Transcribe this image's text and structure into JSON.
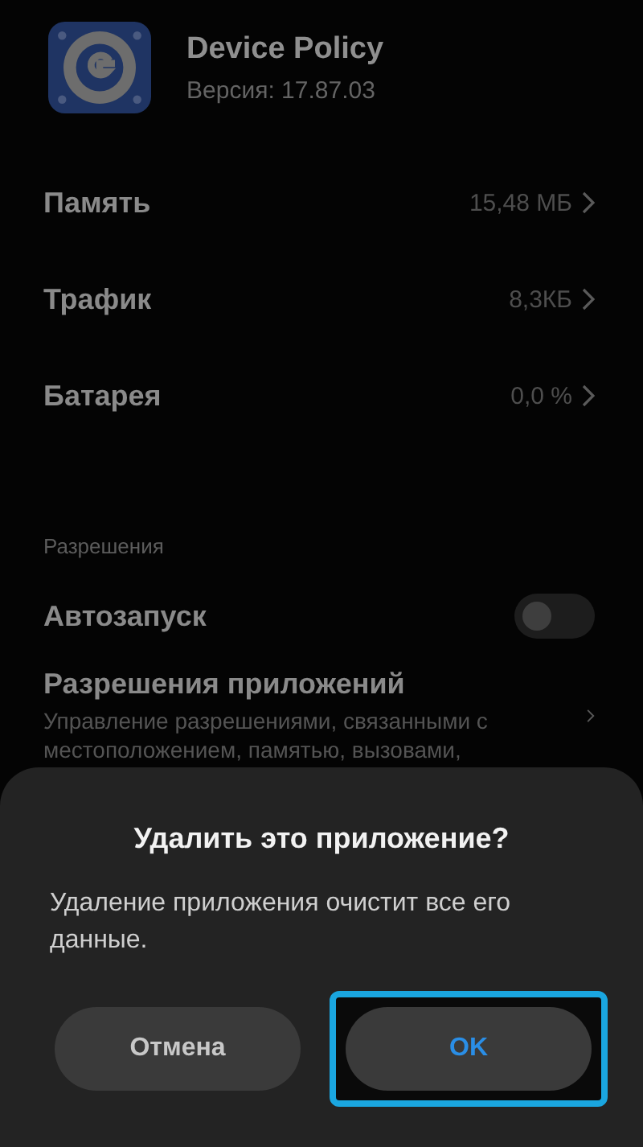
{
  "app": {
    "name": "Device Policy",
    "version": "Версия: 17.87.03"
  },
  "info_rows": [
    {
      "label": "Память",
      "value": "15,48 МБ"
    },
    {
      "label": "Трафик",
      "value": "8,3КБ"
    },
    {
      "label": "Батарея",
      "value": "0,0 %"
    }
  ],
  "section_title": "Разрешения",
  "autostart": {
    "label": "Автозапуск",
    "on": false
  },
  "permissions": {
    "title": "Разрешения приложений",
    "description": "Управление разрешениями, связанными с местоположением, памятью, вызовами,"
  },
  "dialog": {
    "title": "Удалить это приложение?",
    "message": "Удаление приложения очистит все его данные.",
    "buttons": [
      {
        "label": "Отмена",
        "kind": "cancel",
        "highlighted": false
      },
      {
        "label": "OK",
        "kind": "confirm",
        "highlighted": true
      }
    ]
  }
}
